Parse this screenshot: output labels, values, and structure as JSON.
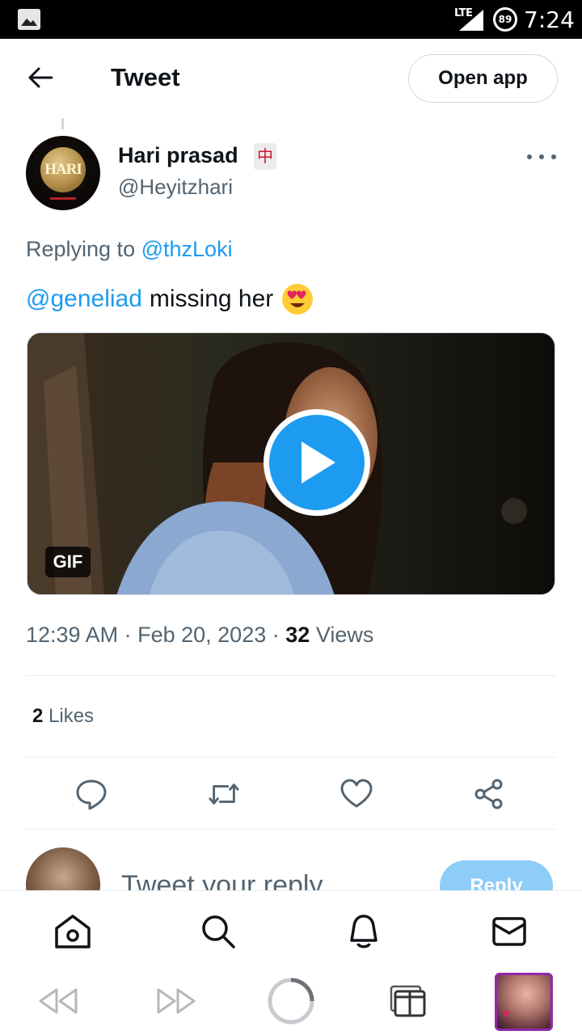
{
  "status_bar": {
    "network": "LTE",
    "battery": "89",
    "time": "7:24"
  },
  "header": {
    "title": "Tweet",
    "open_app_label": "Open app"
  },
  "tweet": {
    "author_name": "Hari prasad",
    "author_badge": "中",
    "author_handle": "@Heyitzhari",
    "avatar_text": "HARI",
    "replying_prefix": "Replying to",
    "replying_to": "@thzLoki",
    "text_mention": "@geneliad",
    "text_body": "missing her",
    "text_emoji": "smiling-face-with-heart-eyes-emoji",
    "media": {
      "badge": "GIF"
    },
    "time": "12:39 AM",
    "date": "Feb 20, 2023",
    "views_count": "32",
    "views_label": "Views",
    "likes_count": "2",
    "likes_label": "Likes",
    "separator": "·"
  },
  "actions": [
    "reply-icon",
    "retweet-icon",
    "like-icon",
    "share-icon"
  ],
  "composer": {
    "placeholder": "Tweet your reply",
    "reply_label": "Reply"
  },
  "bottom_nav": [
    "home-icon",
    "search-icon",
    "notifications-icon",
    "messages-icon"
  ],
  "browser_bar": [
    "back-icon",
    "forward-icon",
    "reload-icon",
    "tabs-icon",
    "tab-thumbnail"
  ],
  "colors": {
    "accent": "#1d9bf0",
    "text_primary": "#0f1419",
    "text_secondary": "#536471",
    "border": "#cfd9de",
    "reply_button_disabled": "#8ecdf8"
  }
}
